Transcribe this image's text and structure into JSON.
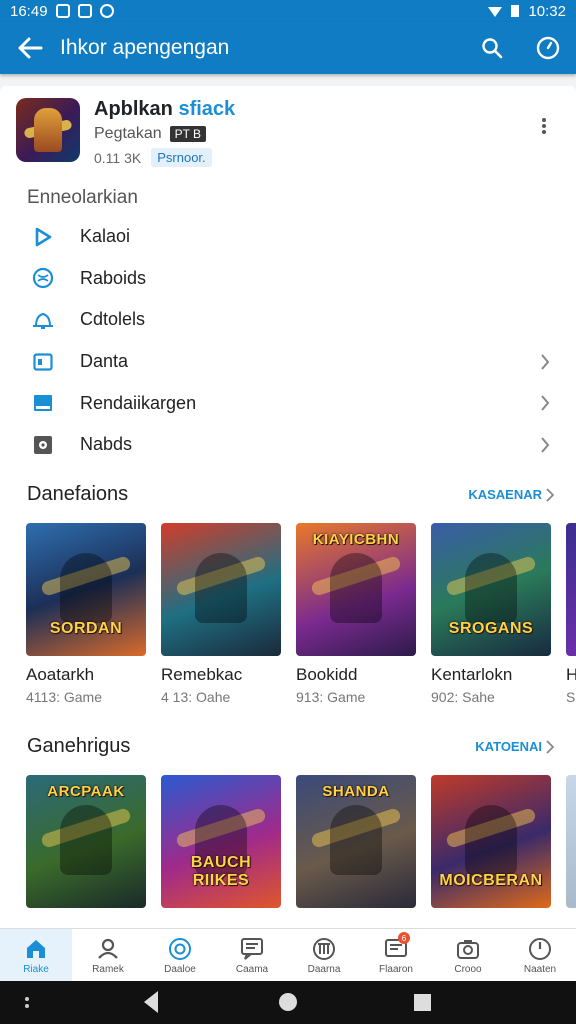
{
  "status": {
    "time_left": "16:49",
    "time_right": "10:32"
  },
  "appbar": {
    "title": "Ihkor apengengan"
  },
  "app": {
    "name_main": "Apblkan",
    "name_accent": "sfiack",
    "publisher": "Pegtakan",
    "publisher_tag": "PT B",
    "rating_text": "0.11 3K",
    "badge": "Psrnoor."
  },
  "section_label": "Enneolarkian",
  "menu": [
    {
      "label": "Kalaoi",
      "icon": "play-triangle-icon",
      "chevron": false
    },
    {
      "label": "Raboids",
      "icon": "globe-icon",
      "chevron": false
    },
    {
      "label": "Cdtolels",
      "icon": "bell-icon",
      "chevron": false
    },
    {
      "label": "Danta",
      "icon": "card-icon",
      "chevron": true
    },
    {
      "label": "Rendaiikargen",
      "icon": "tray-icon",
      "chevron": true
    },
    {
      "label": "Nabds",
      "icon": "gear-square-icon",
      "chevron": true
    }
  ],
  "row1": {
    "title": "Danefaions",
    "more": "KASAENAR",
    "tiles": [
      {
        "name": "Aoatarkh",
        "meta": "4113: Game",
        "banner": "SORDAN",
        "banner_pos": "bottom",
        "bg": "linear-gradient(160deg,#2e6fb0,#1c2f57 50%,#d96b2a)"
      },
      {
        "name": "Remebkac",
        "meta": "4 13: Oahe",
        "banner": "",
        "banner_pos": "bottom",
        "bg": "linear-gradient(160deg,#d13d2b,#1f6f83 55%,#1a2a3a)"
      },
      {
        "name": "Bookidd",
        "meta": "913: Game",
        "banner": "KIAYICBHN",
        "banner_pos": "top",
        "bg": "linear-gradient(160deg,#e8792a,#7a2a8f 60%,#2d1b4a)"
      },
      {
        "name": "Kentarlokn",
        "meta": "902: Sahe",
        "banner": "SROGANS",
        "banner_pos": "bottom",
        "bg": "linear-gradient(160deg,#3a5da8,#2a7a5a 50%,#182a40)"
      },
      {
        "name": "He",
        "meta": "S",
        "banner": "",
        "banner_pos": "bottom",
        "bg": "linear-gradient(160deg,#3b2f8f,#7a2fb0)"
      }
    ]
  },
  "row2": {
    "title": "Ganehrigus",
    "more": "KATOENAI",
    "tiles": [
      {
        "name": "",
        "meta": "",
        "banner": "ARCPAAK",
        "banner_pos": "top",
        "bg": "linear-gradient(160deg,#2b6a7a,#3a6a2a 55%,#1a2a2a)"
      },
      {
        "name": "",
        "meta": "",
        "banner": "BAUCH RIIKES",
        "banner_pos": "bottom",
        "bg": "linear-gradient(160deg,#2a5ad0,#a02a8a 55%,#e0562a)"
      },
      {
        "name": "",
        "meta": "",
        "banner": "SHANDA",
        "banner_pos": "top",
        "bg": "linear-gradient(160deg,#3a4a7a,#6a5a4a 55%,#2a2a3a)"
      },
      {
        "name": "",
        "meta": "",
        "banner": "MOICBERAN",
        "banner_pos": "bottom",
        "bg": "linear-gradient(160deg,#c03a2a,#3a2a6a 55%,#e06a1a)"
      },
      {
        "name": "",
        "meta": "",
        "banner": "",
        "banner_pos": "bottom",
        "bg": "linear-gradient(160deg,#c8d8e8,#a0b0c0)"
      }
    ]
  },
  "bottomnav": [
    {
      "label": "Riake",
      "icon": "home-icon",
      "active": true
    },
    {
      "label": "Ramek",
      "icon": "person-icon",
      "active": false
    },
    {
      "label": "Daaloe",
      "icon": "target-icon",
      "active": false
    },
    {
      "label": "Caama",
      "icon": "chat-icon",
      "active": false
    },
    {
      "label": "Daarna",
      "icon": "bank-icon",
      "active": false
    },
    {
      "label": "Flaaron",
      "icon": "message-badge-icon",
      "active": false,
      "badge": "6"
    },
    {
      "label": "Crooo",
      "icon": "camera-icon",
      "active": false
    },
    {
      "label": "Naaten",
      "icon": "clock-icon",
      "active": false
    }
  ],
  "colors": {
    "primary": "#0f7cc3",
    "accent": "#1a8fd6"
  }
}
